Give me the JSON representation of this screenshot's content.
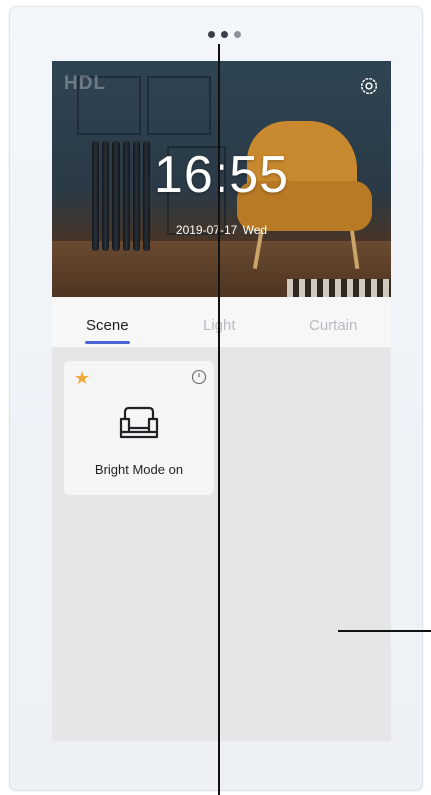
{
  "hero": {
    "logo": "HDL",
    "time": "16:55",
    "date": "2019-07-17  Wed"
  },
  "tabs": [
    {
      "label": "Scene",
      "active": true
    },
    {
      "label": "Light",
      "active": false
    },
    {
      "label": "Curtain",
      "active": false
    }
  ],
  "scene_card": {
    "label": "Bright Mode on",
    "favorite": true,
    "star_icon": "star-icon",
    "timer_icon": "clock-icon",
    "scene_icon": "sofa-icon"
  },
  "colors": {
    "accent": "#4766d1",
    "star": "#f2a93b",
    "screen_bg": "#e5e6e8",
    "frame": "#eef2f7"
  },
  "page_indicator": {
    "count": 3,
    "active": 2
  }
}
